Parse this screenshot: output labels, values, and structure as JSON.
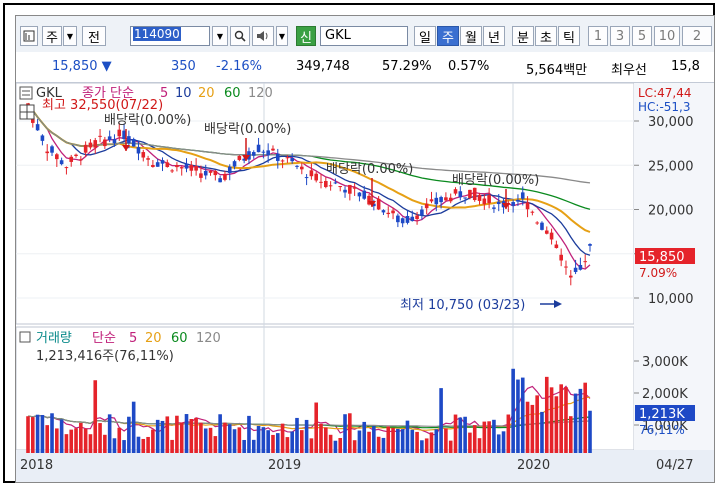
{
  "toolbar": {
    "stock_type": "주",
    "prev_label": "전",
    "code": "114090",
    "new_badge": "신",
    "stock_name": "GKL",
    "period_day": "일",
    "period_week": "주",
    "period_month": "월",
    "period_year": "년",
    "period_minute": "분",
    "period_second": "초",
    "period_tick": "틱",
    "interval_1": "1",
    "interval_3": "3",
    "interval_5": "5",
    "interval_10": "10"
  },
  "quote": {
    "price": "15,850",
    "change": "350",
    "change_pct": "-2.16%",
    "volume": "349,748",
    "ratio1": "57.29%",
    "ratio2": "0.57%",
    "amount": "5,564백만",
    "priority": "최우선",
    "priority_price": "15,8"
  },
  "price_panel": {
    "name": "GKL",
    "ma_label": "종가 단순",
    "ma5": "5",
    "ma10": "10",
    "ma20": "20",
    "ma60": "60",
    "ma120": "120",
    "high_label": "최고 32,550(07/22)",
    "low_label": "최저 10,750 (03/23)",
    "lc_label": "LC:47,44",
    "hc_label": "HC:-51,3",
    "current_price": "15,850",
    "current_pct": "7.09%",
    "dividend_labels": [
      "배당락(0.00%)",
      "배당락(0.00%)",
      "배당락(0.00%)",
      "배당락(0.00%)"
    ],
    "y_ticks": [
      "30,000",
      "25,000",
      "20,000",
      "15,000",
      "10,000"
    ]
  },
  "volume_panel": {
    "title": "거래량",
    "ma_label": "단순",
    "ma5": "5",
    "ma20": "20",
    "ma60": "60",
    "ma120": "120",
    "current_label": "1,213,416주(76,11%)",
    "current_value": "1,213K",
    "current_pct": "76,11%",
    "y_ticks": [
      "3,000K",
      "2,000K",
      "1,000K"
    ]
  },
  "xaxis": {
    "labels": [
      "2018",
      "2019",
      "2020"
    ],
    "right_date": "04/27"
  },
  "colors": {
    "up": "#e5232a",
    "down": "#1e49c6",
    "ma5": "#c0217a",
    "ma10": "#1c3c9c",
    "ma20": "#e6a015",
    "ma60": "#0a8a1e",
    "ma120": "#8a8a8a"
  }
}
